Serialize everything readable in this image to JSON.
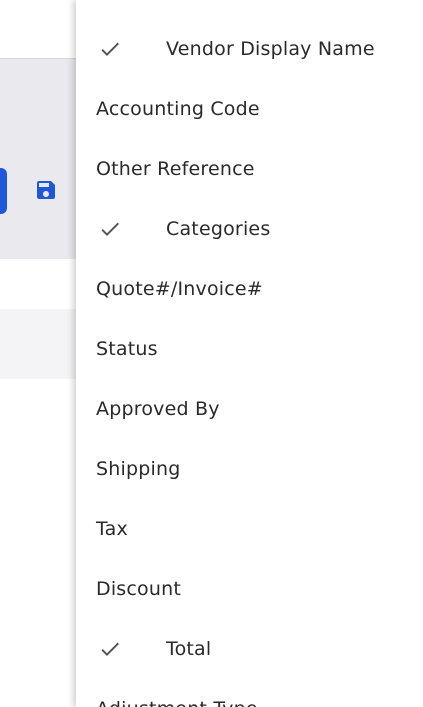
{
  "column_menu": {
    "items": [
      {
        "label": "Vendor Display Name",
        "checked": true
      },
      {
        "label": "Accounting Code",
        "checked": false
      },
      {
        "label": "Other Reference",
        "checked": false
      },
      {
        "label": "Categories",
        "checked": true
      },
      {
        "label": "Quote#/Invoice#",
        "checked": false
      },
      {
        "label": "Status",
        "checked": false
      },
      {
        "label": "Approved By",
        "checked": false
      },
      {
        "label": "Shipping",
        "checked": false
      },
      {
        "label": "Tax",
        "checked": false
      },
      {
        "label": "Discount",
        "checked": false
      },
      {
        "label": "Total",
        "checked": true
      },
      {
        "label": "Adjustment Type",
        "checked": false
      }
    ]
  },
  "icons": {
    "check": "check-icon",
    "save": "save-icon"
  },
  "colors": {
    "accent": "#1f57d8",
    "text": "#2a2a2a",
    "check": "#555555",
    "toolbar_bg": "#e9e9ee"
  }
}
